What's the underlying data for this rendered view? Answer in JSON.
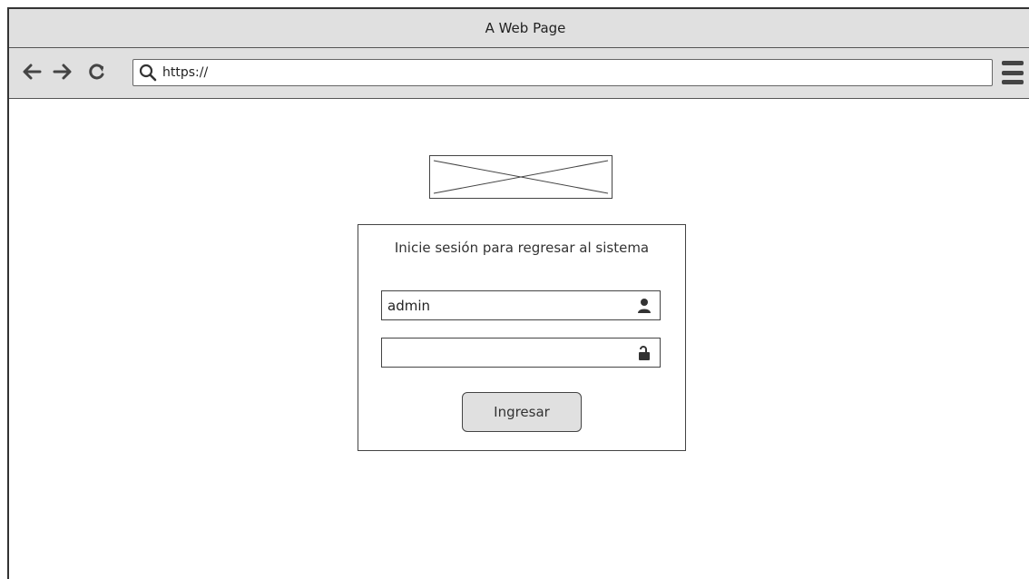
{
  "window": {
    "title": "A Web Page"
  },
  "toolbar": {
    "url": "https://",
    "icons": [
      "back-arrow-icon",
      "forward-arrow-icon",
      "reload-icon",
      "search-icon",
      "hamburger-menu-icon"
    ]
  },
  "login": {
    "prompt": "Inicie sesión para regresar al sistema",
    "username": {
      "value": "admin",
      "icon": "user-icon"
    },
    "password": {
      "value": "",
      "icon": "unlock-icon"
    },
    "submit_label": "Ingresar"
  },
  "colors": {
    "chrome_gray": "#e0e0e0",
    "border": "#444444"
  }
}
